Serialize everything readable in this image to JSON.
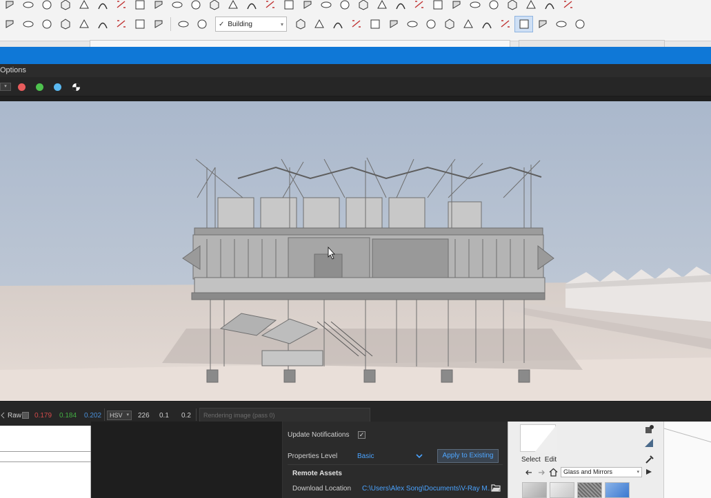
{
  "toolbar": {
    "layer_value": "Building",
    "row1_icons": [
      "arc-icon",
      "offset-icon",
      "follow-me-icon",
      "curve-icon",
      "arc-2pt-icon",
      "text-tool-icon",
      "protractor-icon",
      "axes-icon",
      "section-icon",
      "push-pull-icon",
      "dimension-icon",
      "view-iso-icon",
      "view-top-icon",
      "view-front-icon",
      "view-right-icon",
      "view-back-icon",
      "view-left-icon",
      "style-xray-icon",
      "style-wire-icon",
      "style-hidden-icon",
      "style-shaded-icon",
      "style-textured-icon",
      "style-mono-icon",
      "style-back-edges-icon",
      "sandbox-icon",
      "sandbox-smoove-icon",
      "sandbox-stamp-icon",
      "sandbox-drape-icon",
      "sandbox-detail-icon",
      "sandbox-flip-icon",
      "extension-warehouse-icon"
    ],
    "row2_icons": [
      "paint-bucket-icon",
      "move-tool-icon",
      "rotate-tool-icon",
      "scale-tool-icon",
      "push-icon",
      "pull-icon",
      "offset-2-icon",
      "tape-measure-icon",
      "geo-location-icon",
      "photo-texture-icon",
      "shape-parallelogram-icon",
      "shape-cube-icon",
      "shape-wedge-icon",
      "shape-pyramid-icon",
      "shape-cylinder-icon",
      "shape-sphere-icon",
      "shape-cone-icon",
      "shape-dome-icon",
      "shape-torus-icon",
      "shape-ellipsoid-icon",
      "shape-polyhedron-icon",
      "shape-geodesic-icon",
      "shape-blob-icon",
      "shape-lathe-icon",
      "shape-magnet-icon",
      "vray-asset-editor-icon",
      "vray-render-icon"
    ]
  },
  "vfb": {
    "menu_label": "Options",
    "color_dots": [
      "#e85c5c",
      "#4ec24e",
      "#5ab8f0"
    ],
    "status": {
      "raw_label": "Raw",
      "r_value": "0.179",
      "g_value": "0.184",
      "b_value": "0.202",
      "mode": "HSV",
      "h_value": "226",
      "s_value": "0.1",
      "v_value": "0.2",
      "progress_text": "Rendering image (pass 0)"
    }
  },
  "asset_editor": {
    "update_notifications_label": "Update Notifications",
    "properties_level_label": "Properties Level",
    "properties_level_value": "Basic",
    "apply_button_label": "Apply to Existing",
    "remote_assets_header": "Remote Assets",
    "download_location_label": "Download Location",
    "download_location_value": "C:\\Users\\Alex Song\\Documents\\V-Ray M..."
  },
  "materials": {
    "tab_select": "Select",
    "tab_edit": "Edit",
    "collection": "Glass and Mirrors"
  }
}
